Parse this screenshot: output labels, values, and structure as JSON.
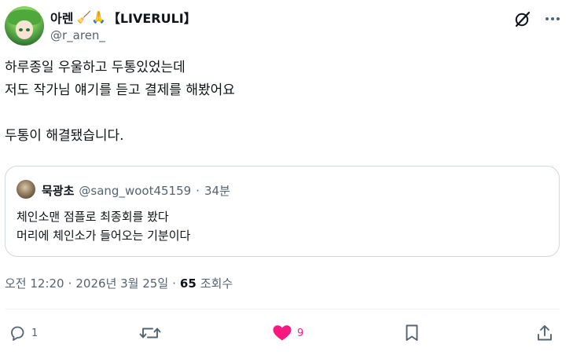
{
  "author": {
    "display_name": "아렌",
    "name_emoji": "🧹🙏",
    "name_tag": "【LIVERULI】",
    "handle": "@r_aren_"
  },
  "tweet": {
    "lines": [
      "하루종일 우울하고 두통있었는데",
      "저도 작가님 얘기를 듣고 결제를 해봤어요",
      "",
      "두통이 해결됐습니다."
    ]
  },
  "quote": {
    "name": "묵광초",
    "handle": "@sang_woot45159",
    "separator": "·",
    "time": "34분",
    "lines": [
      "체인소맨 점플로 최종회를 봤다",
      "머리에 체인소가 들어오는 기분이다"
    ]
  },
  "meta": {
    "time": "오전 12:20",
    "separator1": "·",
    "date": "2026년 3월 25일",
    "separator2": "·",
    "views_count": "65",
    "views_label": "조회수"
  },
  "actions": {
    "reply_count": "1",
    "like_count": "9"
  },
  "colors": {
    "like_active": "#f91880",
    "secondary_text": "#536471",
    "border": "#cfd9de"
  },
  "icons": [
    "grok-icon",
    "more-icon",
    "reply-icon",
    "retweet-icon",
    "heart-filled-icon",
    "bookmark-icon",
    "share-icon"
  ]
}
